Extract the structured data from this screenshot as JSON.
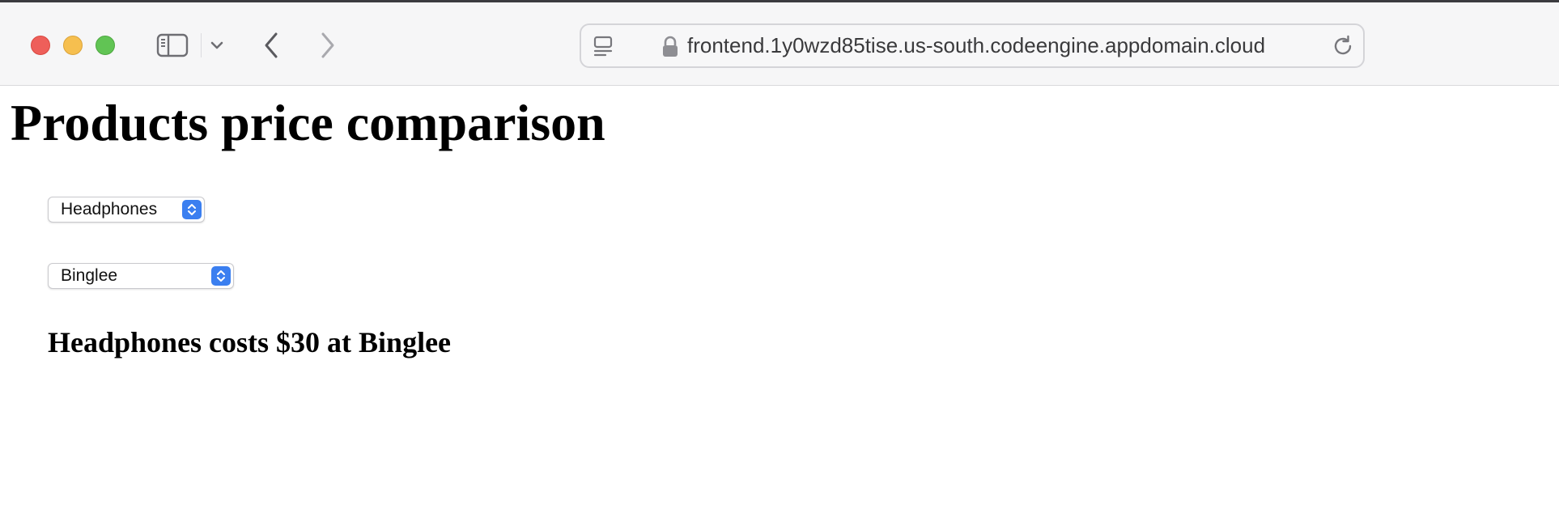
{
  "browser": {
    "url": "frontend.1y0wzd85tise.us-south.codeengine.appdomain.cloud",
    "icons": {
      "close": "close-window-icon",
      "minimize": "minimize-window-icon",
      "zoom": "zoom-window-icon",
      "sidebar": "sidebar-icon",
      "tab_group_menu": "chevron-down-icon",
      "back": "chevron-left-icon",
      "forward": "chevron-right-icon",
      "reader": "reader-mode-icon",
      "lock": "lock-icon",
      "reload": "reload-icon"
    },
    "colors": {
      "close": "#ee5f5a",
      "minimize": "#f6bf4f",
      "zoom": "#61c454"
    }
  },
  "page": {
    "title": "Products price comparison",
    "product_select": {
      "selected": "Headphones"
    },
    "store_select": {
      "selected": "Binglee"
    },
    "result": "Headphones costs $30 at Binglee",
    "accent_color": "#3b7ff0"
  }
}
